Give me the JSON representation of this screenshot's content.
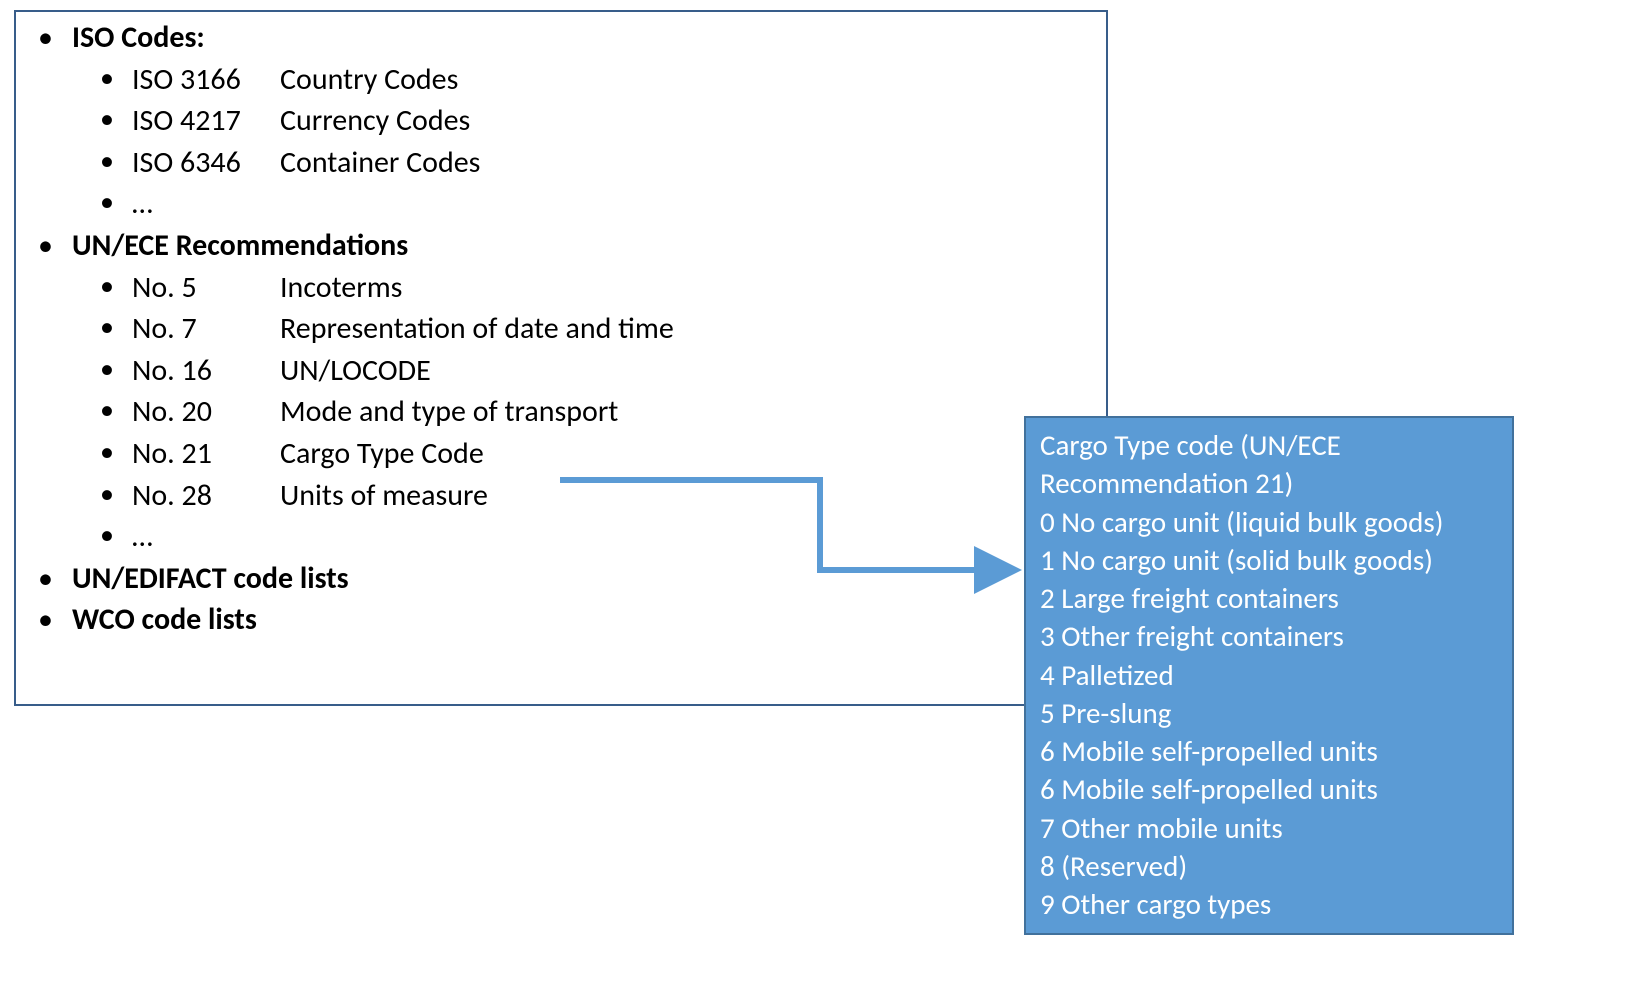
{
  "left": {
    "groups": [
      {
        "label": "ISO Codes:",
        "items": [
          {
            "c1": "ISO 3166",
            "c2": "Country Codes"
          },
          {
            "c1": "ISO 4217",
            "c2": "Currency Codes"
          },
          {
            "c1": "ISO 6346",
            "c2": "Container Codes"
          },
          {
            "c1": "…",
            "c2": ""
          }
        ]
      },
      {
        "label": "UN/ECE Recommendations",
        "items": [
          {
            "c1": "No. 5",
            "c2": "Incoterms"
          },
          {
            "c1": "No. 7",
            "c2": "Representation of date and time"
          },
          {
            "c1": "No. 16",
            "c2": "UN/LOCODE"
          },
          {
            "c1": "No. 20",
            "c2": "Mode and type of transport"
          },
          {
            "c1": "No. 21",
            "c2": "Cargo Type Code"
          },
          {
            "c1": "No. 28",
            "c2": "Units of measure"
          },
          {
            "c1": "…",
            "c2": ""
          }
        ]
      },
      {
        "label": "UN/EDIFACT code lists",
        "items": []
      },
      {
        "label": "WCO code lists",
        "items": []
      }
    ]
  },
  "right": {
    "title_line1": "Cargo Type code (UN/ECE",
    "title_line2": "Recommendation 21)",
    "entries": [
      "0 No cargo unit (liquid bulk goods)",
      "1 No cargo unit (solid bulk goods)",
      "2 Large freight containers",
      "3 Other freight containers",
      "4 Palletized",
      "5 Pre-slung",
      "6 Mobile self-propelled units",
      "6 Mobile self-propelled units",
      "7 Other mobile units",
      "8 (Reserved)",
      "9 Other cargo types"
    ]
  },
  "colors": {
    "box_border": "#385D8A",
    "accent_fill": "#5B9BD5",
    "accent_border": "#41719C",
    "arrow": "#5B9BD5"
  }
}
